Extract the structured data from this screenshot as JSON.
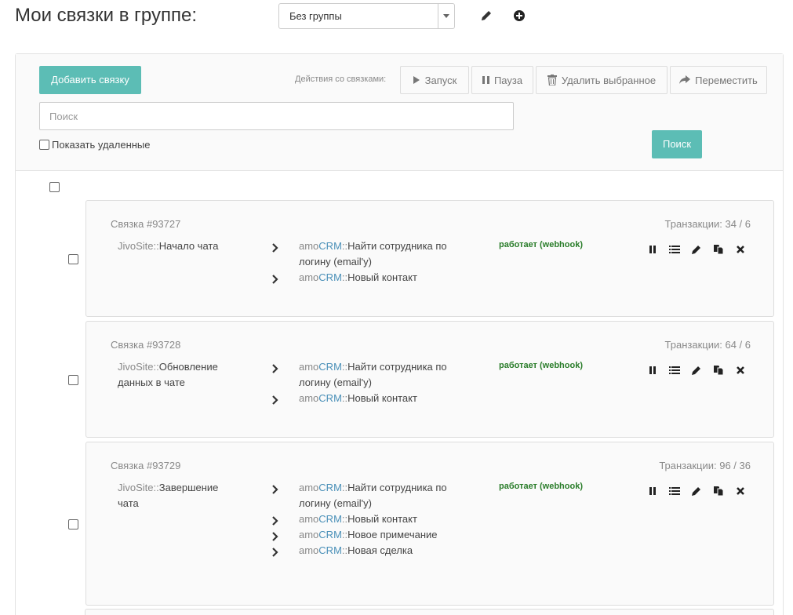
{
  "header": {
    "title": "Мои связки в группе:",
    "group_select": "Без группы"
  },
  "toolbar": {
    "add_button": "Добавить связку",
    "actions_label": "Действия со связками:",
    "start": "Запуск",
    "pause": "Пауза",
    "delete_selected": "Удалить выбранное",
    "move": "Переместить",
    "search_placeholder": "Поиск",
    "search_value": "",
    "show_deleted": "Показать удаленные",
    "search_button": "Поиск"
  },
  "colors": {
    "accent": "#5cbdb5",
    "status_ok": "#2a7d2a",
    "service_crm": "#4a90b8"
  },
  "cards": [
    {
      "id": "Связка #93727",
      "transactions": "Транзакции: 34 / 6",
      "source": {
        "service": "JivoSite",
        "sep": "::",
        "action": "Начало чата"
      },
      "status": "работает (webhook)",
      "actions": [
        {
          "a": "amo",
          "b": "CRM",
          "sep": "::",
          "text": "Найти сотрудника по логину (email'у)"
        },
        {
          "a": "amo",
          "b": "CRM",
          "sep": "::",
          "text": "Новый контакт"
        }
      ]
    },
    {
      "id": "Связка #93728",
      "transactions": "Транзакции: 64 / 6",
      "source": {
        "service": "JivoSite",
        "sep": "::",
        "action": "Обновление данных в чате"
      },
      "status": "работает (webhook)",
      "actions": [
        {
          "a": "amo",
          "b": "CRM",
          "sep": "::",
          "text": "Найти сотрудника по логину (email'у)"
        },
        {
          "a": "amo",
          "b": "CRM",
          "sep": "::",
          "text": "Новый контакт"
        }
      ]
    },
    {
      "id": "Связка #93729",
      "transactions": "Транзакции: 96 / 36",
      "source": {
        "service": "JivoSite",
        "sep": "::",
        "action": "Завершение чата"
      },
      "status": "работает (webhook)",
      "actions": [
        {
          "a": "amo",
          "b": "CRM",
          "sep": "::",
          "text": "Найти сотрудника по логину (email'у)"
        },
        {
          "a": "amo",
          "b": "CRM",
          "sep": "::",
          "text": "Новый контакт"
        },
        {
          "a": "amo",
          "b": "CRM",
          "sep": "::",
          "text": "Новое примечание"
        },
        {
          "a": "amo",
          "b": "CRM",
          "sep": "::",
          "text": "Новая сделка"
        }
      ]
    }
  ]
}
